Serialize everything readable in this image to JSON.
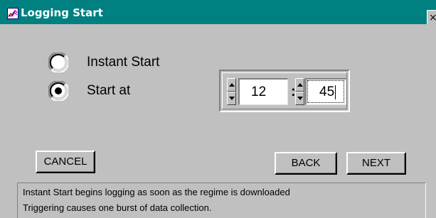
{
  "window": {
    "title": "Logging Start",
    "close_glyph": "×",
    "icon": "app-icon"
  },
  "start_mode": {
    "options": [
      {
        "label": "Instant Start",
        "selected": false
      },
      {
        "label": "Start at",
        "selected": true
      }
    ]
  },
  "start_time": {
    "hours": "12",
    "separator": ":",
    "minutes": "45"
  },
  "buttons": {
    "cancel": "CANCEL",
    "back": "BACK",
    "next": "NEXT"
  },
  "info": {
    "lines": [
      "Instant Start begins logging as soon as the regime is downloaded",
      "Triggering causes one burst of data collection."
    ]
  },
  "colors": {
    "titlebar": "#008080",
    "face": "#c0c0c0"
  }
}
